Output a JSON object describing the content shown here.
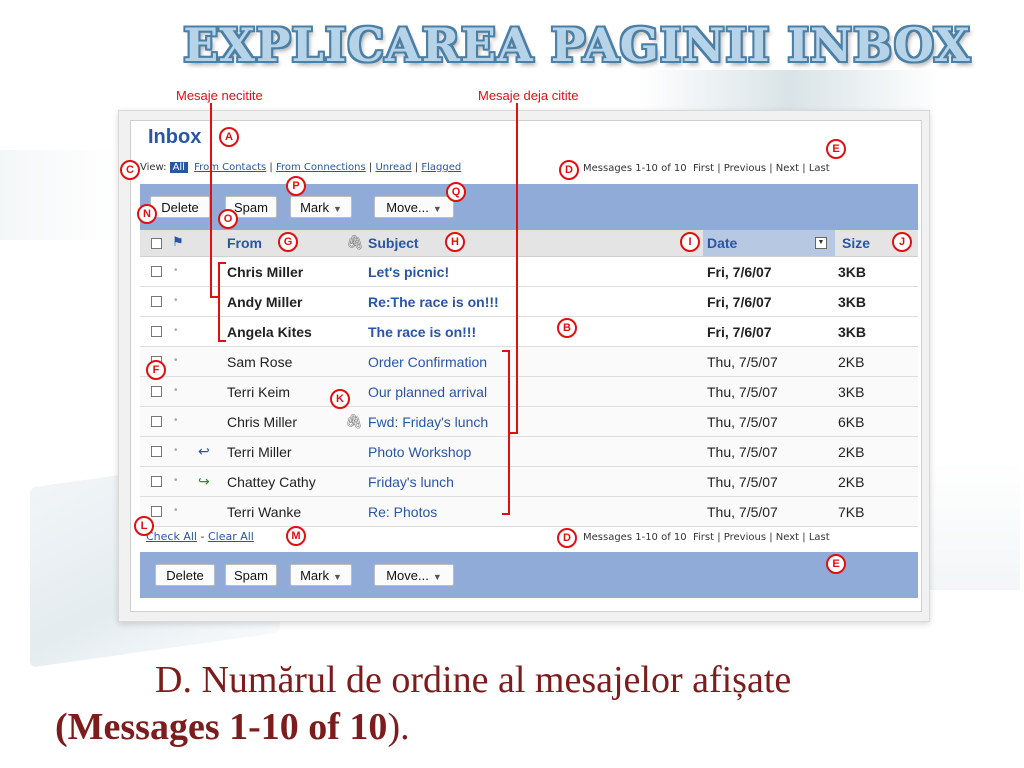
{
  "slide": {
    "title": "EXPLICAREA PAGINII INBOX",
    "callout_unread": "Mesaje necitite",
    "callout_read": "Mesaje deja citite",
    "caption_line1": "D. Numărul de ordine al mesajelor afișate",
    "caption_line2_bold": "(Messages 1-10 of 10",
    "caption_line2_end": ")."
  },
  "inbox": {
    "title": "Inbox",
    "view_label": "View:",
    "view_all": "All",
    "filters": [
      "From Contacts",
      "From Connections",
      "Unread",
      "Flagged"
    ],
    "pager_text": "Messages 1-10 of 10",
    "pager_links": [
      "First",
      "Previous",
      "Next",
      "Last"
    ],
    "buttons": {
      "delete": "Delete",
      "spam": "Spam",
      "mark": "Mark",
      "move": "Move..."
    },
    "columns": {
      "from": "From",
      "subject": "Subject",
      "date": "Date",
      "size": "Size"
    },
    "messages": [
      {
        "from": "Chris Miller",
        "subject": "Let's picnic!",
        "date": "Fri, 7/6/07",
        "size": "3KB",
        "unread": true
      },
      {
        "from": "Andy Miller",
        "subject": "Re:The race is on!!!",
        "date": "Fri, 7/6/07",
        "size": "3KB",
        "unread": true
      },
      {
        "from": "Angela Kites",
        "subject": "The race is on!!!",
        "date": "Fri, 7/6/07",
        "size": "3KB",
        "unread": true
      },
      {
        "from": "Sam Rose",
        "subject": "Order Confirmation",
        "date": "Thu, 7/5/07",
        "size": "2KB",
        "unread": false
      },
      {
        "from": "Terri Keim",
        "subject": "Our planned arrival",
        "date": "Thu, 7/5/07",
        "size": "3KB",
        "unread": false
      },
      {
        "from": "Chris Miller",
        "subject": "Fwd: Friday's lunch",
        "date": "Thu, 7/5/07",
        "size": "6KB",
        "unread": false,
        "attachment": true
      },
      {
        "from": "Terri Miller",
        "subject": "Photo Workshop",
        "date": "Thu, 7/5/07",
        "size": "2KB",
        "unread": false,
        "status_icon": "reply-arrow-icon"
      },
      {
        "from": "Chattey Cathy",
        "subject": "Friday's lunch",
        "date": "Thu, 7/5/07",
        "size": "2KB",
        "unread": false,
        "status_icon": "forward-arrow-icon"
      },
      {
        "from": "Terri Wanke",
        "subject": "Re: Photos",
        "date": "Thu, 7/5/07",
        "size": "7KB",
        "unread": false
      }
    ],
    "check_all": "Check All",
    "clear_all": "Clear All"
  },
  "badges": [
    "A",
    "B",
    "C",
    "D",
    "E",
    "F",
    "G",
    "H",
    "I",
    "J",
    "K",
    "L",
    "M",
    "N",
    "O",
    "P",
    "Q"
  ],
  "colors": {
    "accent_blue": "#2955a6",
    "button_bar": "#91abd8",
    "callout_red": "#e01010",
    "caption": "#7d1c1c"
  }
}
